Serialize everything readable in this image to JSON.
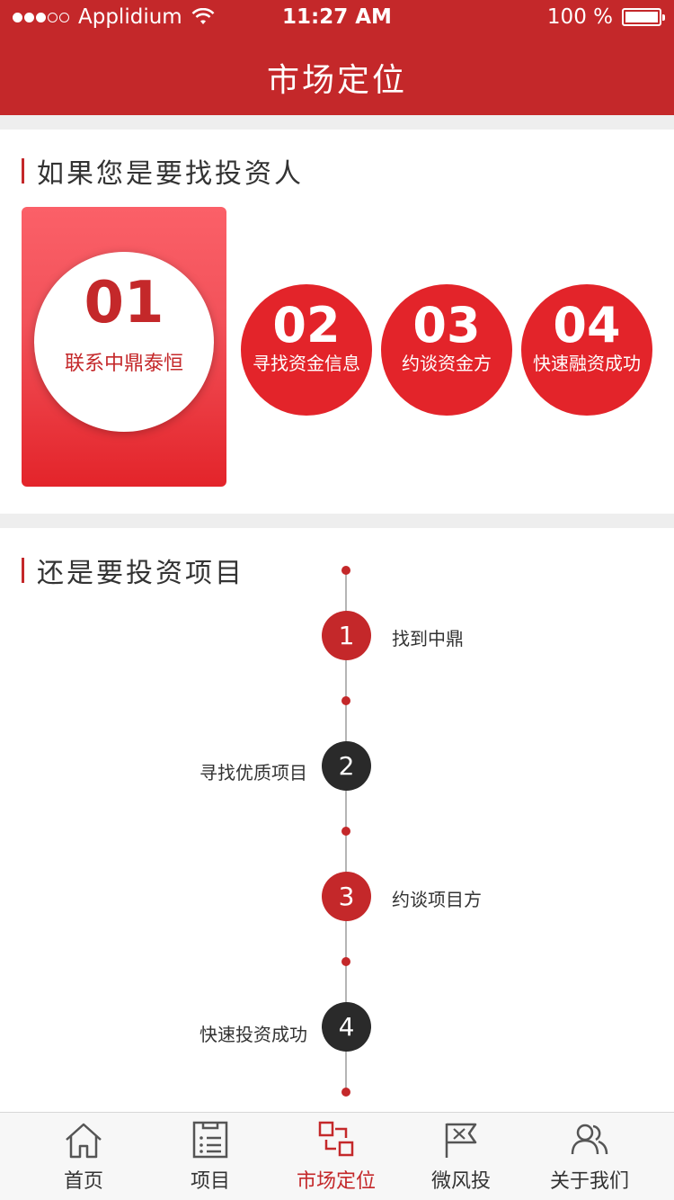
{
  "status_bar": {
    "carrier": "Applidium",
    "time": "11:27 AM",
    "battery": "100 %"
  },
  "nav": {
    "title": "市场定位"
  },
  "section_investor": {
    "title": "如果您是要找投资人",
    "steps": [
      {
        "number": "01",
        "label": "联系中鼎泰恒"
      },
      {
        "number": "02",
        "label": "寻找资金信息"
      },
      {
        "number": "03",
        "label": "约谈资金方"
      },
      {
        "number": "04",
        "label": "快速融资成功"
      }
    ]
  },
  "section_project": {
    "title": "还是要投资项目",
    "timeline": [
      {
        "number": "1",
        "label": "找到中鼎",
        "side": "right",
        "color": "#c4282a"
      },
      {
        "number": "2",
        "label": "寻找优质项目",
        "side": "left",
        "color": "#2a2a2a"
      },
      {
        "number": "3",
        "label": "约谈项目方",
        "side": "right",
        "color": "#c4282a"
      },
      {
        "number": "4",
        "label": "快速投资成功",
        "side": "left",
        "color": "#2a2a2a"
      }
    ]
  },
  "tabbar": {
    "items": [
      {
        "label": "首页",
        "icon": "home-icon",
        "active": false
      },
      {
        "label": "项目",
        "icon": "list-document-icon",
        "active": false
      },
      {
        "label": "市场定位",
        "icon": "market-position-icon",
        "active": true
      },
      {
        "label": "微风投",
        "icon": "flag-icon",
        "active": false
      },
      {
        "label": "关于我们",
        "icon": "people-icon",
        "active": false
      }
    ]
  },
  "colors": {
    "brand_red": "#c4282a",
    "step_red": "#e3242a",
    "dark_node": "#2a2a2a"
  }
}
